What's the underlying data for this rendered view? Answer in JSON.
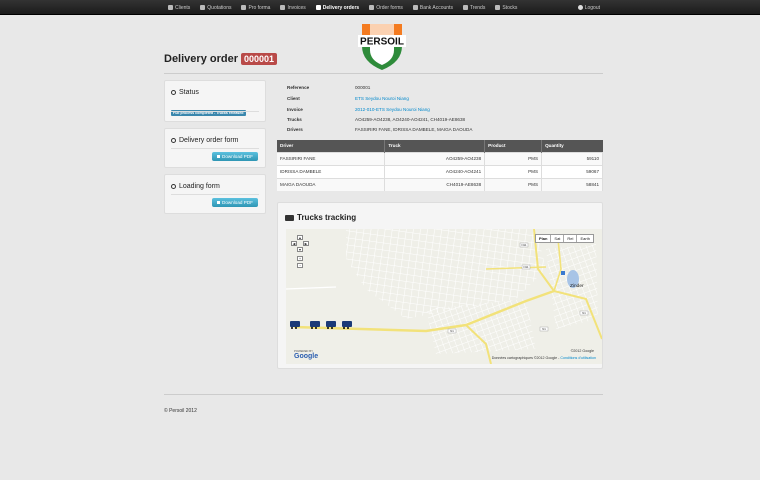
{
  "nav": {
    "items": [
      {
        "label": "Clients",
        "icon": "user-icon"
      },
      {
        "label": "Quotations",
        "icon": "list-icon"
      },
      {
        "label": "Pro forma",
        "icon": "document-icon"
      },
      {
        "label": "Invoices",
        "icon": "document-icon"
      },
      {
        "label": "Delivery orders",
        "icon": "truck-icon",
        "active": true
      },
      {
        "label": "Order forms",
        "icon": "folder-icon"
      },
      {
        "label": "Bank Accounts",
        "icon": "bank-icon"
      },
      {
        "label": "Trends",
        "icon": "trend-icon"
      },
      {
        "label": "Stocks",
        "icon": "drop-icon"
      }
    ],
    "logout": "Logout"
  },
  "logo": {
    "text": "PERSOIL",
    "colors": {
      "orange": "#f47b20",
      "green": "#2e8b3a",
      "white": "#ffffff"
    }
  },
  "page": {
    "title": "Delivery order",
    "order_id": "000001"
  },
  "status": {
    "title": "Status",
    "label": "Full process completed - Trucks released"
  },
  "delivery_form": {
    "title": "Delivery order form",
    "button": "Download PDF"
  },
  "loading_form": {
    "title": "Loading form",
    "button": "Download PDF"
  },
  "info": {
    "reference": {
      "key": "Reference",
      "value": "000001"
    },
    "client": {
      "key": "Client",
      "value": "ETS Seydou Nouroi Niang"
    },
    "invoice": {
      "key": "Invoice",
      "value": "2012-010-ETS Seydou Nouroi Niang"
    },
    "trucks": {
      "key": "Trucks",
      "value": "AO4259-AO4238, AO4240-AO4241, CH4019-AE8638"
    },
    "drivers": {
      "key": "Drivers",
      "value": "FASSIRIRI FANE, IDRISSA DAMBELE, MAIGA DAOUDA"
    }
  },
  "table": {
    "headers": [
      "Driver",
      "Truck",
      "Product",
      "Quantity"
    ],
    "rows": [
      [
        "FASSIRIRI FANE",
        "AO4259-AO4238",
        "PMS",
        "59110"
      ],
      [
        "IDRISSA DAMBELE",
        "AO4240-AO4241",
        "PMS",
        "59067"
      ],
      [
        "MAIGA DAOUDA",
        "CH4019-AE8638",
        "PMS",
        "58841"
      ]
    ]
  },
  "tracking": {
    "title": "Trucks tracking",
    "map_types": [
      "Plan",
      "Sat",
      "Rel",
      "Earth"
    ],
    "city": "Zinder",
    "copyright": "©2012 Google",
    "data_credit": "Données cartographiques ©2012 Google -",
    "terms": "Conditions d'utilisation",
    "powered_by": "POWERED BY",
    "google": "Google",
    "road_labels": [
      "N1",
      "N11",
      "N11",
      "N1",
      "N1"
    ]
  },
  "footer": "© Persoil 2012"
}
